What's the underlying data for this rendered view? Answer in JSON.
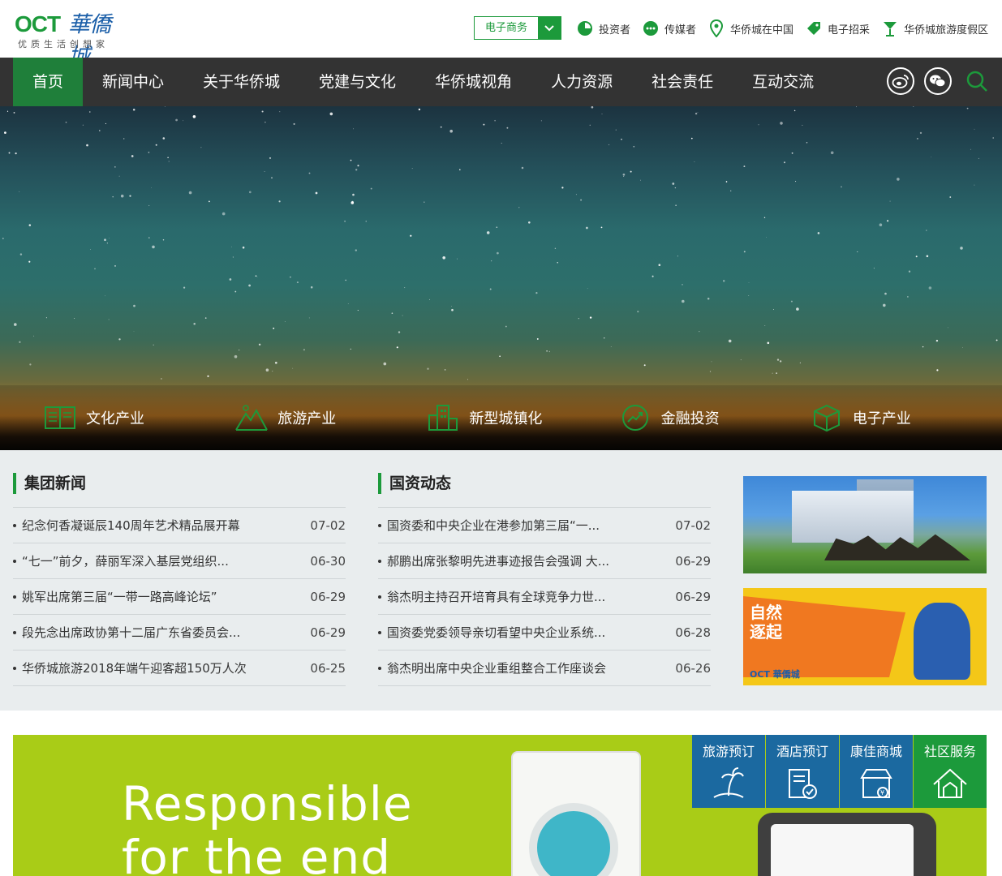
{
  "logo": {
    "oct": "OCT",
    "cn": "華僑城",
    "slogan": "优质生活创想家"
  },
  "ecommerce": {
    "label": "电子商务"
  },
  "top_links": [
    {
      "label": "投资者",
      "icon": "pie-chart-icon"
    },
    {
      "label": "传媒者",
      "icon": "chat-dots-icon"
    },
    {
      "label": "华侨城在中国",
      "icon": "location-pin-icon"
    },
    {
      "label": "电子招采",
      "icon": "tag-icon"
    },
    {
      "label": "华侨城旅游度假区",
      "icon": "cocktail-icon"
    }
  ],
  "nav": {
    "items": [
      "首页",
      "新闻中心",
      "关于华侨城",
      "党建与文化",
      "华侨城视角",
      "人力资源",
      "社会责任",
      "互动交流"
    ],
    "active": "首页"
  },
  "industries": [
    {
      "label": "文化产业",
      "icon": "book-icon"
    },
    {
      "label": "旅游产业",
      "icon": "mountain-icon"
    },
    {
      "label": "新型城镇化",
      "icon": "building-icon"
    },
    {
      "label": "金融投资",
      "icon": "growth-chart-icon"
    },
    {
      "label": "电子产业",
      "icon": "box-icon"
    }
  ],
  "group_news": {
    "title": "集团新闻",
    "items": [
      {
        "title": "纪念何香凝诞辰140周年艺术精品展开幕",
        "date": "07-02"
      },
      {
        "title": "“七一”前夕，薛丽军深入基层党组织...",
        "date": "06-30"
      },
      {
        "title": "姚军出席第三届“一带一路高峰论坛”",
        "date": "06-29"
      },
      {
        "title": "段先念出席政协第十二届广东省委员会...",
        "date": "06-29"
      },
      {
        "title": "华侨城旅游2018年端午迎客超150万人次",
        "date": "06-25"
      }
    ]
  },
  "sasac_news": {
    "title": "国资动态",
    "items": [
      {
        "title": "国资委和中央企业在港参加第三届“一...",
        "date": "07-02"
      },
      {
        "title": "郝鹏出席张黎明先进事迹报告会强调 大...",
        "date": "06-29"
      },
      {
        "title": "翁杰明主持召开培育具有全球竞争力世...",
        "date": "06-29"
      },
      {
        "title": "国资委党委领导亲切看望中央企业系统...",
        "date": "06-28"
      },
      {
        "title": "翁杰明出席中央企业重组整合工作座谈会",
        "date": "06-26"
      }
    ]
  },
  "side_images": [
    {
      "name": "headquarters-photo"
    },
    {
      "name": "festival-poster",
      "caption": "自然逐起",
      "brand": "OCT 華僑城"
    }
  ],
  "promo": {
    "line1": "Responsible",
    "line2": "for the end"
  },
  "services": [
    {
      "label": "旅游预订",
      "icon": "island-icon",
      "color": "#1b69a0"
    },
    {
      "label": "酒店预订",
      "icon": "hotel-check-icon",
      "color": "#1b69a0"
    },
    {
      "label": "康佳商城",
      "icon": "shop-icon",
      "color": "#1b69a0"
    },
    {
      "label": "社区服务",
      "icon": "home-icon",
      "color": "#1c9a3b"
    }
  ],
  "colors": {
    "brand_green": "#1c9a3b",
    "nav_bg": "#333333",
    "nav_active": "#1f7f3a",
    "service_blue": "#1b69a0",
    "promo_lime": "#a9cc17"
  }
}
